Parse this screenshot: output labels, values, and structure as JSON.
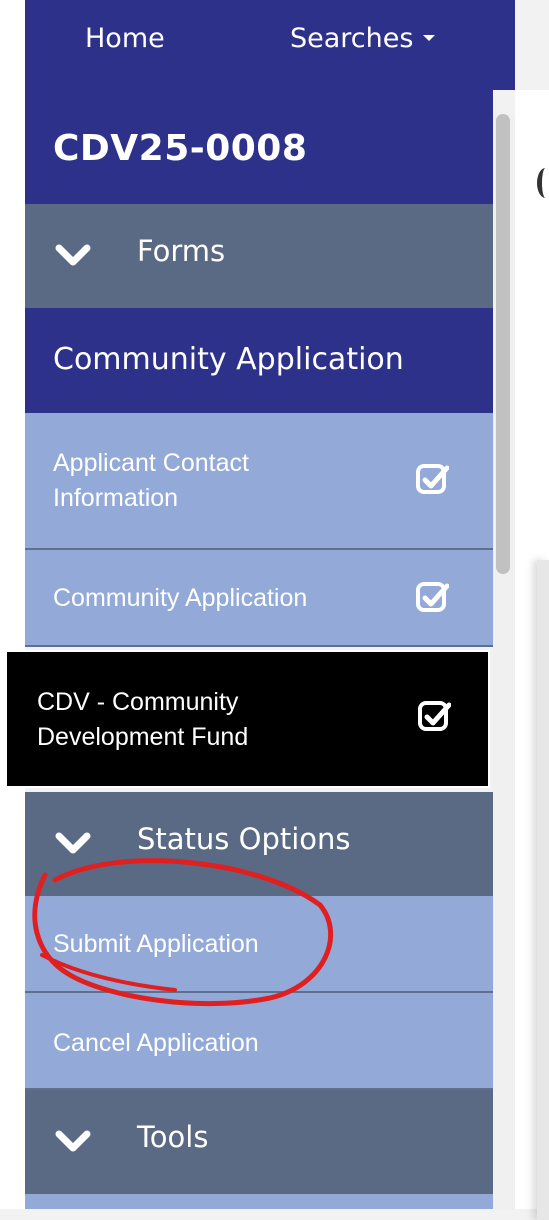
{
  "nav": {
    "home": "Home",
    "searches": "Searches"
  },
  "sidebar": {
    "case_id": "CDV25-0008",
    "forms_section": "Forms",
    "group_title": "Community Application",
    "items": [
      {
        "label_line1": "Applicant Contact",
        "label_line2": "Information",
        "checked": true
      },
      {
        "label": "Community Application",
        "checked": true
      },
      {
        "label_line1": "CDV - Community",
        "label_line2": "Development Fund",
        "checked": true,
        "active": true
      }
    ],
    "status_section": "Status Options",
    "status_items": [
      "Submit Application",
      "Cancel Application"
    ],
    "tools_section": "Tools"
  },
  "icons": {
    "section": "chevron-down-icon",
    "form_state": "checkbox-checked-icon"
  },
  "colors": {
    "primary": "#2e318a",
    "section": "#5a6984",
    "item": "#93a9d8",
    "active": "#000000",
    "annotation": "#e02020"
  }
}
